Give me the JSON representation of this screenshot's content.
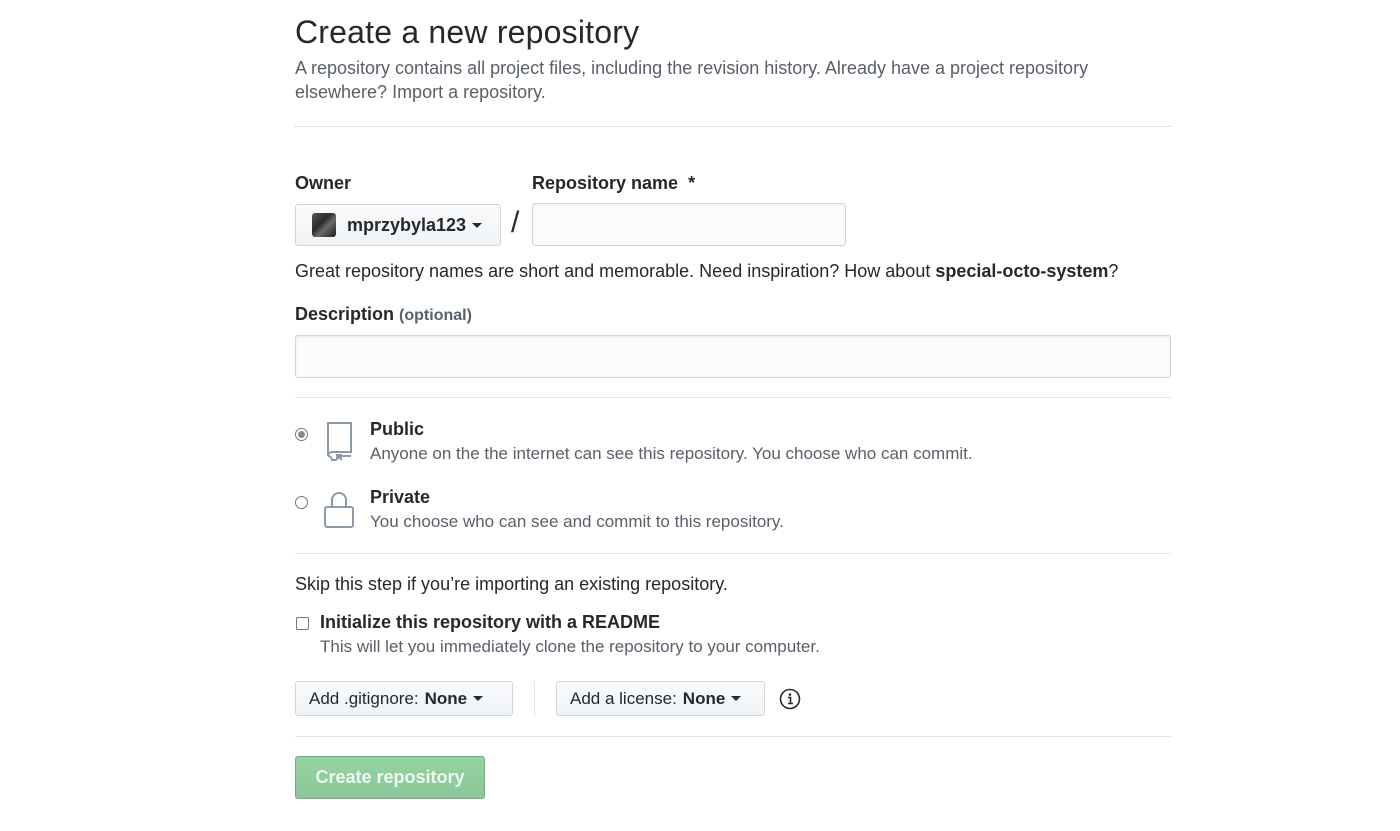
{
  "header": {
    "title": "Create a new repository",
    "description_line1": "A repository contains all project files, including the revision history. Already have a project repository",
    "description_line2_text": "elsewhere? ",
    "import_link": "Import a repository."
  },
  "owner": {
    "label": "Owner",
    "selected": "mprzybyla123"
  },
  "separator": "/",
  "repo_name": {
    "label": "Repository name",
    "required_marker": "*",
    "value": ""
  },
  "name_hint": {
    "prefix": "Great repository names are short and memorable. Need inspiration? How about ",
    "suggestion": "special-octo-system",
    "suffix": "?"
  },
  "description": {
    "label": "Description",
    "optional": "(optional)",
    "value": ""
  },
  "visibility": {
    "options": [
      {
        "title": "Public",
        "note": "Anyone on the the internet can see this repository. You choose who can commit.",
        "checked": true,
        "icon": "repo-book-icon"
      },
      {
        "title": "Private",
        "note": "You choose who can see and commit to this repository.",
        "checked": false,
        "icon": "lock-icon"
      }
    ]
  },
  "init": {
    "skip_note": "Skip this step if you’re importing an existing repository.",
    "readme_title": "Initialize this repository with a README",
    "readme_note": "This will let you immediately clone the repository to your computer.",
    "readme_checked": false
  },
  "gitignore": {
    "label": "Add .gitignore:",
    "value": "None"
  },
  "license": {
    "label": "Add a license:",
    "value": "None"
  },
  "info_icon": "info-icon",
  "submit": {
    "label": "Create repository",
    "enabled": false
  },
  "colors": {
    "accent_green_disabled": "#94d3a2",
    "text_primary": "#24292e",
    "text_muted": "#586069",
    "border": "#d1d5da"
  }
}
